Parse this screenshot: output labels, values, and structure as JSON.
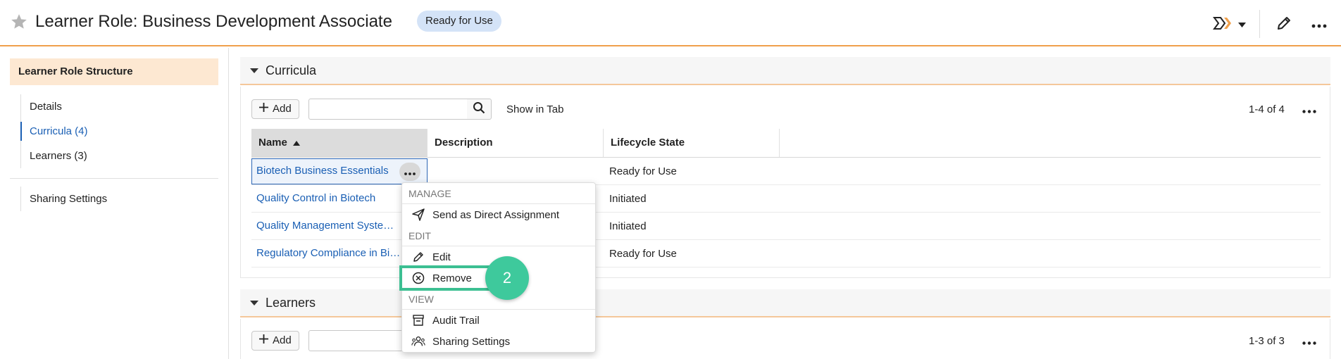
{
  "header": {
    "title": "Learner Role: Business Development Associate",
    "status": "Ready for Use"
  },
  "leftnav": {
    "heading": "Learner Role Structure",
    "items": [
      {
        "label": "Details"
      },
      {
        "label": "Curricula (4)"
      },
      {
        "label": "Learners (3)"
      }
    ],
    "sharing": "Sharing Settings"
  },
  "curricula": {
    "title": "Curricula",
    "add_label": "Add",
    "search_value": "",
    "show_in_tab": "Show in Tab",
    "count": "1-4 of 4",
    "columns": [
      "Name",
      "Description",
      "Lifecycle State"
    ],
    "rows": [
      {
        "name": "Biotech Business Essentials",
        "description": "",
        "state": "Ready for Use"
      },
      {
        "name": "Quality Control in Biotech",
        "description": "",
        "state": "Initiated"
      },
      {
        "name": "Quality Management Syste…",
        "description": "",
        "state": "Initiated"
      },
      {
        "name": "Regulatory Compliance in Bi…",
        "description": "",
        "state": "Ready for Use"
      }
    ]
  },
  "learners": {
    "title": "Learners",
    "add_label": "Add",
    "search_value": "",
    "count": "1-3 of 3"
  },
  "context_menu": {
    "groups": [
      {
        "label": "MANAGE",
        "items": [
          {
            "label": "Send as Direct Assignment",
            "icon": "send-icon"
          }
        ]
      },
      {
        "label": "EDIT",
        "items": [
          {
            "label": "Edit",
            "icon": "pencil-icon"
          },
          {
            "label": "Remove",
            "icon": "remove-circle-icon"
          }
        ]
      },
      {
        "label": "VIEW",
        "items": [
          {
            "label": "Audit Trail",
            "icon": "audit-trail-icon"
          },
          {
            "label": "Sharing Settings",
            "icon": "users-icon"
          }
        ]
      }
    ]
  },
  "step_badge": "2",
  "colors": {
    "accent_orange": "#f0a04b",
    "link_blue": "#1a5fb4",
    "badge_blue": "#d4e3f7",
    "highlight_green": "#3cbf92"
  }
}
